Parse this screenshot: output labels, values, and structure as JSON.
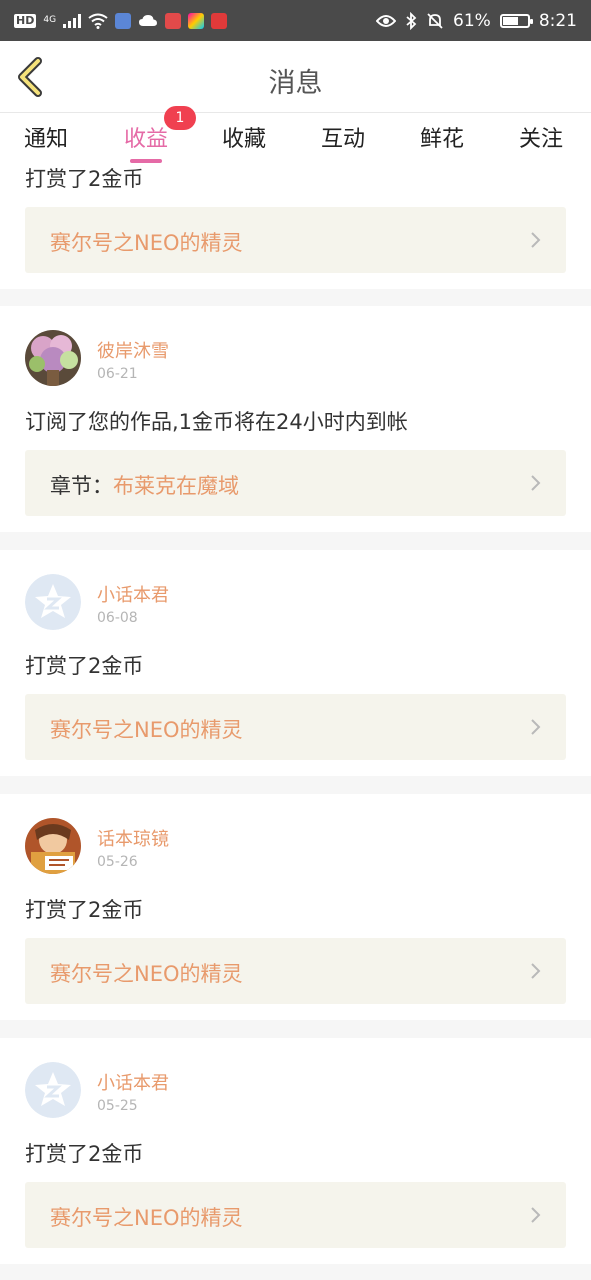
{
  "status_bar": {
    "network": "4G",
    "battery": "61%",
    "battery_level": 0.61,
    "time": "8:21"
  },
  "header": {
    "title": "消息",
    "back_icon": "chevron-left-icon"
  },
  "tabs": [
    {
      "label": "通知",
      "active": false
    },
    {
      "label": "收益",
      "active": true,
      "badge": "1"
    },
    {
      "label": "收藏",
      "active": false
    },
    {
      "label": "互动",
      "active": false
    },
    {
      "label": "鲜花",
      "active": false
    },
    {
      "label": "关注",
      "active": false
    }
  ],
  "feed": {
    "partial_top": {
      "message": "打赏了2金币",
      "reference": "赛尔号之NEO的精灵"
    },
    "items": [
      {
        "user": "彼岸沐雪",
        "date": "06-21",
        "avatar": "flowers-photo",
        "message": "订阅了您的作品,1金币将在24小时内到帐",
        "reference_label": "章节：",
        "reference": "布莱克在魔域"
      },
      {
        "user": "小话本君",
        "date": "06-08",
        "avatar": "default-avatar-icon",
        "message": "打赏了2金币",
        "reference_label": "",
        "reference": "赛尔号之NEO的精灵"
      },
      {
        "user": "话本琼镜",
        "date": "05-26",
        "avatar": "character-photo",
        "message": "打赏了2金币",
        "reference_label": "",
        "reference": "赛尔号之NEO的精灵"
      },
      {
        "user": "小话本君",
        "date": "05-25",
        "avatar": "default-avatar-icon",
        "message": "打赏了2金币",
        "reference_label": "",
        "reference": "赛尔号之NEO的精灵"
      }
    ]
  },
  "colors": {
    "accent": "#e56aa6",
    "username": "#e89a6c",
    "badge": "#f04050"
  }
}
